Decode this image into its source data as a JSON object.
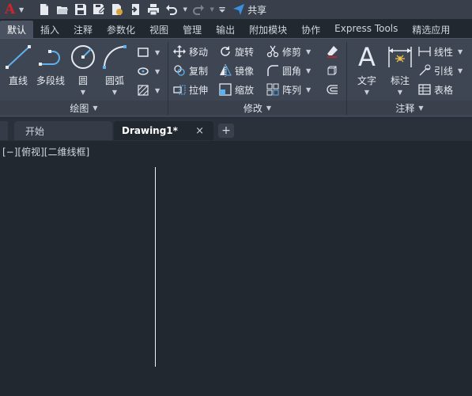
{
  "app": {
    "logo_letter": "A",
    "accent_color": "#d0232a",
    "share_label": "共享",
    "quick_access_icons": [
      "new-icon",
      "open-icon",
      "save-icon",
      "save-as-icon",
      "publish-icon",
      "export-icon",
      "print-icon",
      "undo-icon",
      "redo-icon",
      "customize-icon"
    ]
  },
  "ribbon_tabs": [
    "默认",
    "插入",
    "注释",
    "参数化",
    "视图",
    "管理",
    "输出",
    "附加模块",
    "协作",
    "Express Tools",
    "精选应用"
  ],
  "panels": {
    "draw": {
      "title": "绘图",
      "line": "直线",
      "polyline": "多段线",
      "circle": "圆",
      "arc": "圆弧"
    },
    "modify": {
      "title": "修改",
      "move": "移动",
      "rotate": "旋转",
      "trim": "修剪",
      "copy": "复制",
      "mirror": "镜像",
      "fillet": "圆角",
      "stretch": "拉伸",
      "scale": "缩放",
      "array": "阵列"
    },
    "annotation": {
      "title": "注释",
      "text": "文字",
      "dimension": "标注",
      "linear": "线性",
      "leader": "引线",
      "table": "表格"
    }
  },
  "file_tabs": {
    "start": "开始",
    "drawing": "Drawing1*",
    "close_symbol": "×",
    "add_symbol": "+"
  },
  "viewport_label": "[−][俯视][二维线框]"
}
